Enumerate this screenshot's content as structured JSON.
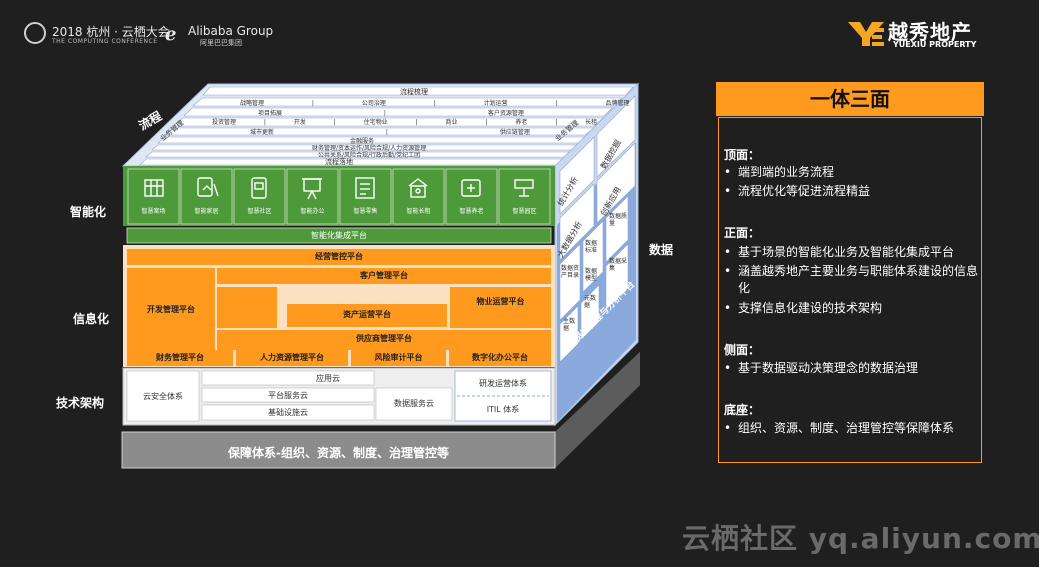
{
  "header": {
    "conference_title": "2018 杭州 · 云栖大会",
    "conference_subtitle": "THE COMPUTING CONFERENCE",
    "alibaba_title": "Alibaba Group",
    "alibaba_sub": "阿里巴巴集团",
    "yuexiu_title": "越秀地产",
    "yuexiu_sub": "YUEXIU PROPERTY"
  },
  "side_labels": {
    "process": "流程",
    "intelligence": "智能化",
    "informatization": "信息化",
    "tech": "技术架构",
    "data": "数据"
  },
  "top_face": {
    "rows": [
      "流程梳理",
      "战略管理 | 公司治理 | 计划运营 | 品牌管理",
      "项目拓展 | 客户资源管理",
      "投资管理 | 开发 | 住宅物业 | 商业 | 养老 | 长租",
      "城市更新 | 供应链管理",
      "金融服务",
      "财务管理/资本运作/风险合规/人力资源管理",
      "公共关系/风险合规/行政后勤/党纪工团",
      "流程落地"
    ],
    "left_tag": "业务管理",
    "right_tag": "业务管理"
  },
  "smart_apps": [
    "智慧案场",
    "智能家居",
    "智慧社区",
    "智能办公",
    "智慧零售",
    "智能长租",
    "智慧养老",
    "智慧园区"
  ],
  "smart_platform": "智能化集成平台",
  "info": {
    "operation": "经营管控平台",
    "customer": "客户管理平台",
    "dev": "开发管理平台",
    "property_ops": "物业运营平台",
    "asset": "资产运营平台",
    "supply": "供应商管理平台",
    "bottom": [
      "财务管理平台",
      "人力资源管理平台",
      "风险审计平台",
      "数字化办公平台"
    ]
  },
  "tech": {
    "security": "云安全体系",
    "app_cloud": "应用云",
    "platform_cloud": "平台服务云",
    "infra_cloud": "基础设施云",
    "data_cloud": "数据服务云",
    "devops": "研发运营体系",
    "itil": "ITIL 体系"
  },
  "right_face": {
    "stat": "统计分析",
    "mining": "数据挖掘",
    "bigdata": "大数据分析",
    "innovation": "创新应用",
    "quality": "数据质量",
    "standard": "数据标准",
    "catalog": "数据资产目录",
    "model": "数据模型",
    "collect": "数据采集",
    "master": "主数据",
    "meta": "元数据",
    "governance": "数据资产管理与分析平台"
  },
  "base": "保障体系-组织、资源、制度、治理管控等",
  "panel": {
    "title": "一体三面",
    "sections": [
      {
        "title": "顶面：",
        "items": [
          "端到端的业务流程",
          "流程优化等促进流程精益"
        ]
      },
      {
        "title": "正面：",
        "items": [
          "基于场景的智能化业务及智能化集成平台",
          "涵盖越秀地产主要业务与职能体系建设的信息化",
          "支撑信息化建设的技术架构"
        ]
      },
      {
        "title": "侧面：",
        "items": [
          "基于数据驱动决策理念的数据治理"
        ]
      },
      {
        "title": "底座：",
        "items": [
          "组织、资源、制度、治理管控等保障体系"
        ]
      }
    ]
  },
  "watermark": "云栖社区 yq.aliyun.com",
  "colors": {
    "orange": "#ff9a1e",
    "green": "#4e9a3b",
    "blue": "#8aa9dc",
    "bg": "#1f1f1f"
  }
}
